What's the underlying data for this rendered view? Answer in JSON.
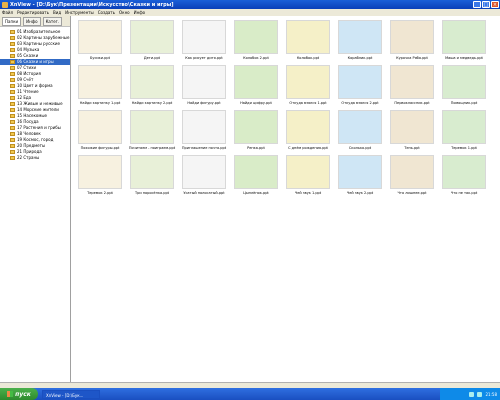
{
  "window": {
    "title": "XnView - [D:\\Бук\\Презентации\\Искусство\\Сказки и игры]",
    "controls": [
      "_",
      "□",
      "×"
    ]
  },
  "menu": [
    "Файл",
    "Редактировать",
    "Вид",
    "Инструменты",
    "Создать",
    "Окно",
    "Инфо"
  ],
  "sidebar": {
    "tabs": [
      "Папки",
      "Инфо",
      "Катег."
    ],
    "items": [
      "01 Изобразительное",
      "02 Картины зарубежные",
      "03 Картины русские",
      "04 Музыка",
      "05 Сказки",
      "06 Сказки и игры",
      "07 Стихи",
      "08 История",
      "09 Счёт",
      "10 Цвет и форма",
      "11 Чтение",
      "12 Еда",
      "13 Живые и неживые",
      "14 Морские жители",
      "15 Насекомые",
      "16 Посуда",
      "17 Растения и грибы",
      "18 Человек",
      "19 Космос, город",
      "20 Предметы",
      "21 Природа",
      "22 Страны"
    ],
    "selected_index": 5
  },
  "thumbnails": [
    "Бусики.ppt",
    "Дети.ppt",
    "Как рисует дитя.ppt",
    "Колобок 2.ppt",
    "Колобок.ppt",
    "Кораблик.ppt",
    "Курочка Ряба.ppt",
    "Маша и медведь.ppt",
    "Найди картинку 1.ppt",
    "Найди картинку 2.ppt",
    "Найди фигуру.ppt",
    "Найди цифру.ppt",
    "Откуда взялся 1.ppt",
    "Откуда взялся 2.ppt",
    "Первоклассник.ppt",
    "Помощник.ppt",
    "Похожие фигуры.ppt",
    "Почитаем - поиграем.ppt",
    "Приглашение почта.ppt",
    "Репка.ppt",
    "С днём рождения.ppt",
    "Сколько.ppt",
    "Тень.ppt",
    "Теремок 1.ppt",
    "Теремок 2.ppt",
    "Три поросёнка.ppt",
    "Усатый полосатый.ppt",
    "Цыплёнок.ppt",
    "Чей звук 1.ppt",
    "Чей звук 2.ppt",
    "Что лишнее.ppt",
    "Что не так.ppt"
  ],
  "taskbar": {
    "start_label": "пуск",
    "task_label": "XnView - [D:\\Бук...",
    "clock": "21:58"
  }
}
